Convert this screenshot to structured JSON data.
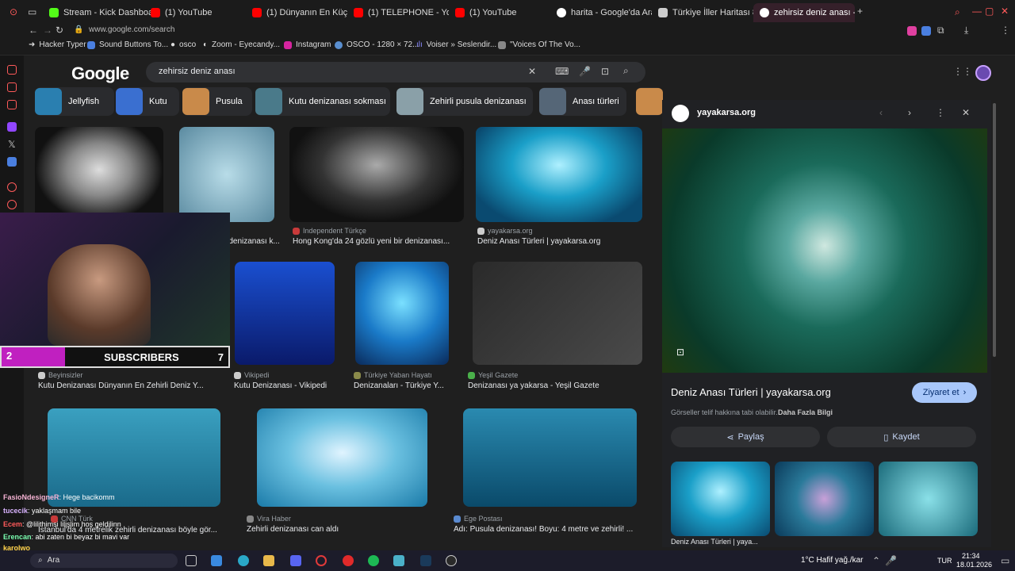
{
  "tabs": [
    {
      "label": "Stream - Kick Dashboard",
      "color": "#53fc18"
    },
    {
      "label": "(1) YouTube",
      "color": "#ff0000"
    },
    {
      "label": "(1) Dünyanın En Küçük Evi",
      "color": "#ff0000"
    },
    {
      "label": "(1) TELEPHONE - YouTube",
      "color": "#ff0000"
    },
    {
      "label": "(1) YouTube",
      "color": "#ff0000"
    },
    {
      "label": "harita - Google'da Ara",
      "color": "#ffffff"
    },
    {
      "label": "Türkiye İller Haritası 81 İl",
      "color": "#cccccc"
    },
    {
      "label": "zehirsiz deniz anası - Goo",
      "color": "#ffffff"
    }
  ],
  "address": "www.google.com/search",
  "bookmarks": [
    "Hacker Typer",
    "Sound Buttons To...",
    "osco",
    "Zoom - Eyecandy...",
    "Instagram",
    "OSCO - 1280 × 72...",
    "Voiser » Seslendir...",
    "\"Voices Of The Vo..."
  ],
  "google": {
    "logo": "Google",
    "query": "zehirsiz deniz anası"
  },
  "chips": [
    {
      "label": "Jellyfish",
      "color": "#2a7fb0"
    },
    {
      "label": "Kutu",
      "color": "#3a6fd0"
    },
    {
      "label": "Pusula",
      "color": "#c98a4a"
    },
    {
      "label": "Kutu denizanası sokması",
      "color": "#4a7a8a"
    },
    {
      "label": "Zehirli pusula denizanası",
      "color": "#8aa0a8"
    },
    {
      "label": "Anası türleri",
      "color": "#556677"
    }
  ],
  "results": [
    {
      "source": "",
      "title": "",
      "color": "#4a4a4a"
    },
    {
      "source": "",
      "title": "...denizanası k...",
      "color": "#7ab6c8"
    },
    {
      "source": "Independent Türkçe",
      "title": "Hong Kong'da 24 gözlü yeni bir denizanası...",
      "color": "#3a3a3a"
    },
    {
      "source": "yayakarsa.org",
      "title": "Deniz Anası Türleri | yayakarsa.org",
      "color": "#1a8fb8"
    },
    {
      "source": "",
      "title": "",
      "color": "#1a4fd0"
    },
    {
      "source": "",
      "title": "",
      "color": "#1aa0e0"
    },
    {
      "source": "Beyinsizler",
      "title": "Kutu Denizanası Dünyanın En Zehirli Deniz Y...",
      "color": "#000"
    },
    {
      "source": "Vikipedi",
      "title": "Kutu Denizanası - Vikipedi",
      "color": "#000"
    },
    {
      "source": "Türkiye Yaban Hayatı",
      "title": "Denizanaları - Türkiye Y...",
      "color": "#000"
    },
    {
      "source": "Yeşil Gazete",
      "title": "Denizanası ya yakarsa - Yeşil Gazete",
      "color": "#3a3a3a"
    },
    {
      "source": "Vira Haber",
      "title": "Zehirli denizanası can aldı",
      "color": "#2a9ac8"
    },
    {
      "source": "Ege Postası",
      "title": "Adı: Pusula denizanası! Boyu: 4 metre ve zehirli! ...",
      "color": "#1a7aa8"
    },
    {
      "source": "CNN Türk",
      "title": "İstanbul'da 4 metrelik zehirli denizanası böyle gör...",
      "color": "#2a8ab0"
    }
  ],
  "preview": {
    "site": "yayakarsa.org",
    "title": "Deniz Anası Türleri | yayakarsa.org",
    "visit": "Ziyaret et",
    "copyright": "Görseller telif hakkına tabi olabilir.",
    "more_info": "Daha Fazla Bilgi",
    "share": "Paylaş",
    "save": "Kaydet",
    "related_caption": "Deniz Anası Türleri | yaya..."
  },
  "stream": {
    "subscribers_label": "SUBSCRIBERS",
    "left_count": "2",
    "right_count": "7"
  },
  "chat": [
    {
      "user": "FasioNdesigneR",
      "text": ": Hege bacikomm",
      "color": "#f7b3d4"
    },
    {
      "user": "tucecik",
      "text": ": yaklaşmam bile",
      "color": "#d9b3ff"
    },
    {
      "user": "Ecem",
      "text": ": @lilithimsi lilişlim hoş geldilinn",
      "color": "#ff5a5a"
    },
    {
      "user": "Erencan",
      "text": ": abi zaten bi beyaz bi mavi var",
      "color": "#7affb0"
    },
    {
      "user": "karolwo",
      "text": "",
      "color": "#ffd24a"
    }
  ],
  "taskbar": {
    "search": "Ara",
    "weather": "1°C  Hafif yağ./kar",
    "lang": "TUR",
    "time": "21:34",
    "date": "18.01.2026"
  }
}
